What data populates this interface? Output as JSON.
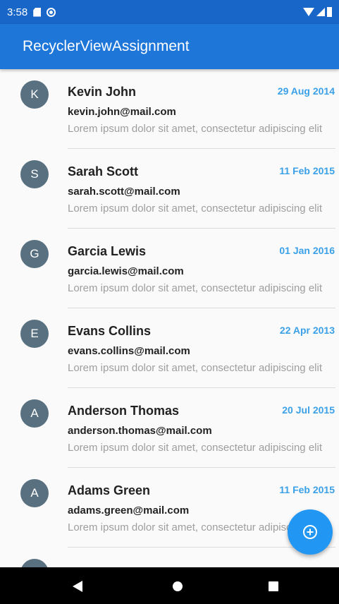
{
  "status_bar": {
    "time": "3:58",
    "icons": [
      "sd-card-icon",
      "sync-icon",
      "wifi-icon",
      "cell-signal-icon",
      "battery-icon"
    ]
  },
  "app_bar": {
    "title": "RecyclerViewAssignment"
  },
  "list": {
    "items": [
      {
        "initial": "K",
        "name": "Kevin John",
        "email": "kevin.john@mail.com",
        "date": "29 Aug 2014",
        "snippet": "Lorem ipsum dolor sit amet, consectetur adipiscing elit"
      },
      {
        "initial": "S",
        "name": "Sarah Scott",
        "email": "sarah.scott@mail.com",
        "date": "11 Feb 2015",
        "snippet": "Lorem ipsum dolor sit amet, consectetur adipiscing elit"
      },
      {
        "initial": "G",
        "name": "Garcia Lewis",
        "email": "garcia.lewis@mail.com",
        "date": "01 Jan 2016",
        "snippet": "Lorem ipsum dolor sit amet, consectetur adipiscing elit"
      },
      {
        "initial": "E",
        "name": "Evans Collins",
        "email": "evans.collins@mail.com",
        "date": "22 Apr 2013",
        "snippet": "Lorem ipsum dolor sit amet, consectetur adipiscing elit"
      },
      {
        "initial": "A",
        "name": "Anderson Thomas",
        "email": "anderson.thomas@mail.com",
        "date": "20 Jul 2015",
        "snippet": "Lorem ipsum dolor sit amet, consectetur adipiscing elit"
      },
      {
        "initial": "A",
        "name": "Adams Green",
        "email": "adams.green@mail.com",
        "date": "11 Feb 2015",
        "snippet": "Lorem ipsum dolor sit amet, consectetur adipiscing elit"
      }
    ]
  },
  "fab": {
    "icon": "add-circle-icon"
  },
  "nav_bar": {
    "icons": [
      "back-icon",
      "home-icon",
      "recents-icon"
    ]
  },
  "colors": {
    "status_bar": "#1766c8",
    "app_bar": "#1e76d9",
    "date_text": "#3aa0e8",
    "avatar_bg": "#58707f",
    "fab": "#2196f3"
  }
}
